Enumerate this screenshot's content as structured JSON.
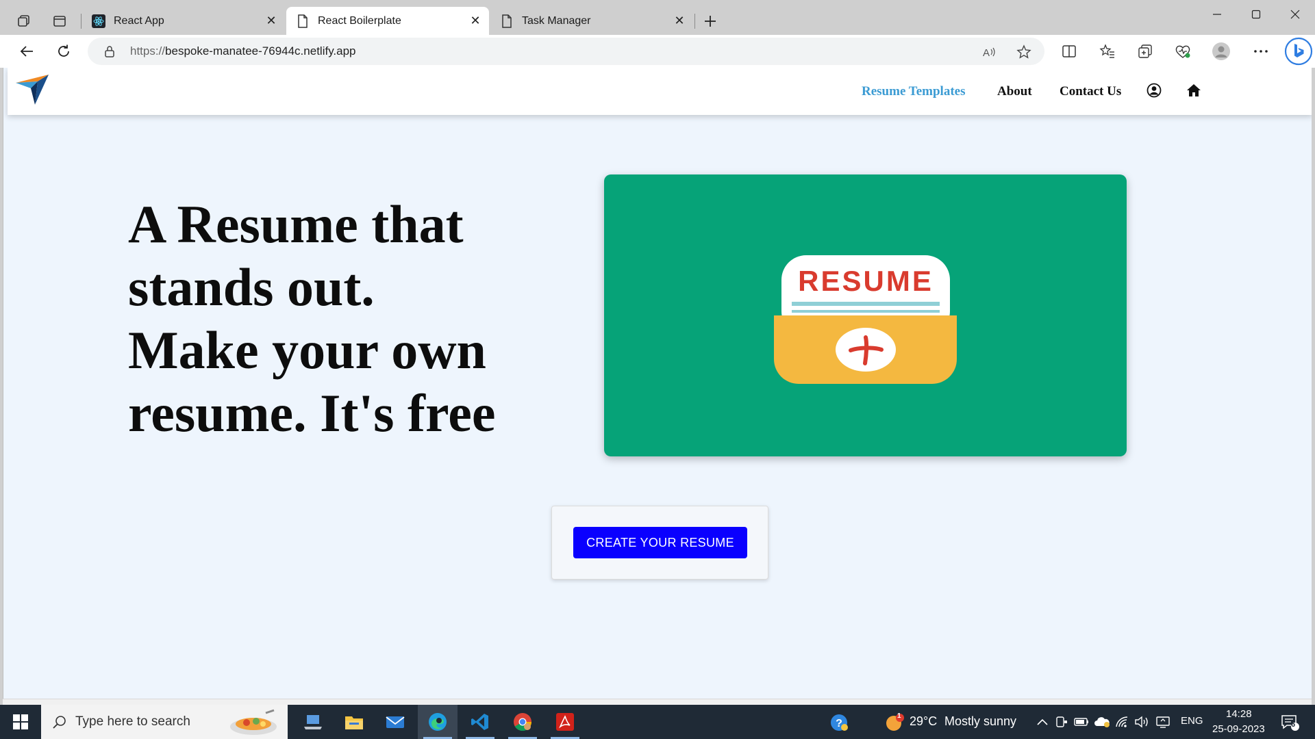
{
  "browser": {
    "tabs": [
      {
        "label": "React App",
        "favicon": "react-icon",
        "active": false
      },
      {
        "label": "React Boilerplate",
        "favicon": "page-icon",
        "active": true
      },
      {
        "label": "Task Manager",
        "favicon": "page-icon",
        "active": false
      }
    ],
    "url_scheme": "https://",
    "url_host": "bespoke-manatee-76944c.netlify.app"
  },
  "site": {
    "nav": {
      "resume_templates": "Resume Templates",
      "about": "About",
      "contact": "Contact Us"
    },
    "hero": {
      "line1": "A Resume that",
      "line2": "stands out.",
      "line3": "Make your own",
      "line4": "resume. It's free"
    },
    "illustration": {
      "label": "RESUME",
      "background_color": "#06a378"
    },
    "cta_label": "CREATE YOUR RESUME",
    "cta_color": "#0a00ff"
  },
  "taskbar": {
    "search_placeholder": "Type here to search",
    "weather_temp": "29°C",
    "weather_desc": "Mostly sunny",
    "language": "ENG",
    "time": "14:28",
    "date": "25-09-2023",
    "notification_count": "6",
    "weather_badge": "1"
  }
}
